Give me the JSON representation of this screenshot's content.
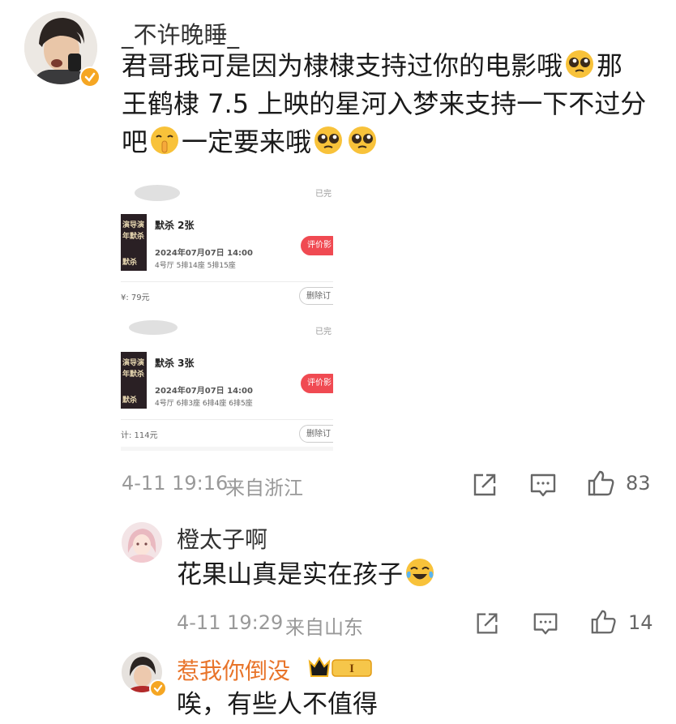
{
  "post": {
    "username": "_不许晚睡_",
    "lines": [
      "君哥我可是因为棣棣支持过你的电影哦",
      "那",
      "王鹤棣 7.5 上映的星河入梦来支持一下不过分",
      "吧",
      "一定要来哦"
    ],
    "timestamp": "4-11 19:16",
    "location": "来自浙江",
    "like_count": "83"
  },
  "tickets": [
    {
      "status": "已完",
      "movie": "默杀 2张",
      "datetime": "2024年07月07日 14:00",
      "seats": "4号厅 5排14座 5排15座",
      "rate_label": "评价影",
      "price": "¥: 79元",
      "delete_label": "删除订"
    },
    {
      "status": "已完",
      "movie": "默杀 3张",
      "datetime": "2024年07月07日 14:00",
      "seats": "4号厅 6排3座 6排4座 6排5座",
      "rate_label": "评价影",
      "price": "计: 114元",
      "delete_label": "删除订"
    }
  ],
  "poster_text": [
    "演导演",
    "年默杀",
    "默杀"
  ],
  "replies": [
    {
      "username": "橙太子啊",
      "text": "花果山真是实在孩子",
      "timestamp": "4-11 19:29",
      "location": "来自山东",
      "like_count": "14"
    },
    {
      "username": "惹我你倒没",
      "badge": "I",
      "text": "唉，有些人不值得"
    }
  ],
  "colors": {
    "verified": "#f5a623",
    "rate_button": "#f04a52",
    "reply_vip_name": "#e8742a",
    "meta_text": "#999999"
  },
  "icons": [
    "verified-badge-icon",
    "share-icon",
    "comment-icon",
    "like-icon",
    "vip-crown-icon"
  ]
}
